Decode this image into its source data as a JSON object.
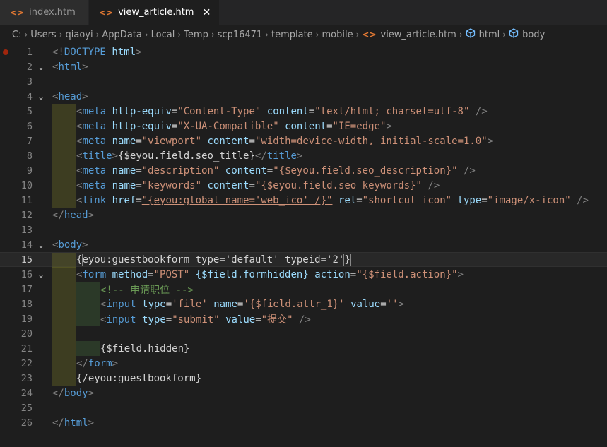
{
  "tabs": [
    {
      "label": "index.htm",
      "active": false
    },
    {
      "label": "view_article.htm",
      "active": true
    }
  ],
  "close_glyph": "✕",
  "breadcrumb": [
    "C:",
    "Users",
    "qiaoyi",
    "AppData",
    "Local",
    "Temp",
    "scp16471",
    "template",
    "mobile",
    "view_article.htm",
    "html",
    "body"
  ],
  "editor": {
    "current_line": 15,
    "breakpoint_line": 1,
    "lines": [
      {
        "n": 1,
        "fold": false,
        "guides": 0,
        "tokens": [
          [
            "br",
            "<!"
          ],
          [
            "tag",
            "DOCTYPE"
          ],
          [
            "txt",
            " "
          ],
          [
            "attr",
            "html"
          ],
          [
            "br",
            ">"
          ]
        ]
      },
      {
        "n": 2,
        "fold": true,
        "guides": 0,
        "tokens": [
          [
            "br",
            "<"
          ],
          [
            "tag",
            "html"
          ],
          [
            "br",
            ">"
          ]
        ]
      },
      {
        "n": 3,
        "fold": false,
        "guides": 0,
        "tokens": []
      },
      {
        "n": 4,
        "fold": true,
        "guides": 0,
        "tokens": [
          [
            "br",
            "<"
          ],
          [
            "tag",
            "head"
          ],
          [
            "br",
            ">"
          ]
        ]
      },
      {
        "n": 5,
        "fold": false,
        "guides": 1,
        "tokens": [
          [
            "br",
            "<"
          ],
          [
            "tag",
            "meta"
          ],
          [
            "txt",
            " "
          ],
          [
            "attr",
            "http-equiv"
          ],
          [
            "txt",
            "="
          ],
          [
            "str",
            "\"Content-Type\""
          ],
          [
            "txt",
            " "
          ],
          [
            "attr",
            "content"
          ],
          [
            "txt",
            "="
          ],
          [
            "str",
            "\"text/html; charset=utf-8\""
          ],
          [
            "txt",
            " "
          ],
          [
            "br",
            "/>"
          ]
        ]
      },
      {
        "n": 6,
        "fold": false,
        "guides": 1,
        "tokens": [
          [
            "br",
            "<"
          ],
          [
            "tag",
            "meta"
          ],
          [
            "txt",
            " "
          ],
          [
            "attr",
            "http-equiv"
          ],
          [
            "txt",
            "="
          ],
          [
            "str",
            "\"X-UA-Compatible\""
          ],
          [
            "txt",
            " "
          ],
          [
            "attr",
            "content"
          ],
          [
            "txt",
            "="
          ],
          [
            "str",
            "\"IE=edge\""
          ],
          [
            "br",
            ">"
          ]
        ]
      },
      {
        "n": 7,
        "fold": false,
        "guides": 1,
        "tokens": [
          [
            "br",
            "<"
          ],
          [
            "tag",
            "meta"
          ],
          [
            "txt",
            " "
          ],
          [
            "attr",
            "name"
          ],
          [
            "txt",
            "="
          ],
          [
            "str",
            "\"viewport\""
          ],
          [
            "txt",
            " "
          ],
          [
            "attr",
            "content"
          ],
          [
            "txt",
            "="
          ],
          [
            "str",
            "\"width=device-width, initial-scale=1.0\""
          ],
          [
            "br",
            ">"
          ]
        ]
      },
      {
        "n": 8,
        "fold": false,
        "guides": 1,
        "tokens": [
          [
            "br",
            "<"
          ],
          [
            "tag",
            "title"
          ],
          [
            "br",
            ">"
          ],
          [
            "txt",
            "{$eyou.field.seo_title}"
          ],
          [
            "br",
            "</"
          ],
          [
            "tag",
            "title"
          ],
          [
            "br",
            ">"
          ]
        ]
      },
      {
        "n": 9,
        "fold": false,
        "guides": 1,
        "tokens": [
          [
            "br",
            "<"
          ],
          [
            "tag",
            "meta"
          ],
          [
            "txt",
            " "
          ],
          [
            "attr",
            "name"
          ],
          [
            "txt",
            "="
          ],
          [
            "str",
            "\"description\""
          ],
          [
            "txt",
            " "
          ],
          [
            "attr",
            "content"
          ],
          [
            "txt",
            "="
          ],
          [
            "str",
            "\"{$eyou.field.seo_description}\""
          ],
          [
            "txt",
            " "
          ],
          [
            "br",
            "/>"
          ]
        ]
      },
      {
        "n": 10,
        "fold": false,
        "guides": 1,
        "tokens": [
          [
            "br",
            "<"
          ],
          [
            "tag",
            "meta"
          ],
          [
            "txt",
            " "
          ],
          [
            "attr",
            "name"
          ],
          [
            "txt",
            "="
          ],
          [
            "str",
            "\"keywords\""
          ],
          [
            "txt",
            " "
          ],
          [
            "attr",
            "content"
          ],
          [
            "txt",
            "="
          ],
          [
            "str",
            "\"{$eyou.field.seo_keywords}\""
          ],
          [
            "txt",
            " "
          ],
          [
            "br",
            "/>"
          ]
        ]
      },
      {
        "n": 11,
        "fold": false,
        "guides": 1,
        "tokens": [
          [
            "br",
            "<"
          ],
          [
            "tag",
            "link"
          ],
          [
            "txt",
            " "
          ],
          [
            "attr",
            "href"
          ],
          [
            "txt",
            "="
          ],
          [
            "strul",
            "\"{eyou:global name='web_ico' /}\""
          ],
          [
            "txt",
            " "
          ],
          [
            "attr",
            "rel"
          ],
          [
            "txt",
            "="
          ],
          [
            "str",
            "\"shortcut icon\""
          ],
          [
            "txt",
            " "
          ],
          [
            "attr",
            "type"
          ],
          [
            "txt",
            "="
          ],
          [
            "str",
            "\"image/x-icon\""
          ],
          [
            "txt",
            " "
          ],
          [
            "br",
            "/>"
          ]
        ]
      },
      {
        "n": 12,
        "fold": false,
        "guides": 0,
        "tokens": [
          [
            "br",
            "</"
          ],
          [
            "tag",
            "head"
          ],
          [
            "br",
            ">"
          ]
        ]
      },
      {
        "n": 13,
        "fold": false,
        "guides": 0,
        "tokens": []
      },
      {
        "n": 14,
        "fold": true,
        "guides": 0,
        "tokens": [
          [
            "br",
            "<"
          ],
          [
            "tag",
            "body"
          ],
          [
            "br",
            ">"
          ]
        ]
      },
      {
        "n": 15,
        "fold": false,
        "guides": 1,
        "tokens": [
          [
            "box",
            "{"
          ],
          [
            "txt",
            "eyou:guestbookform type='default' typeid='2'"
          ],
          [
            "box",
            "}"
          ]
        ]
      },
      {
        "n": 16,
        "fold": true,
        "guides": 1,
        "tokens": [
          [
            "br",
            "<"
          ],
          [
            "tag",
            "form"
          ],
          [
            "txt",
            " "
          ],
          [
            "attr",
            "method"
          ],
          [
            "txt",
            "="
          ],
          [
            "str",
            "\"POST\""
          ],
          [
            "txt",
            " "
          ],
          [
            "attr",
            "{$field.formhidden}"
          ],
          [
            "txt",
            " "
          ],
          [
            "attr",
            "action"
          ],
          [
            "txt",
            "="
          ],
          [
            "str",
            "\"{$field.action}\""
          ],
          [
            "br",
            ">"
          ]
        ]
      },
      {
        "n": 17,
        "fold": false,
        "guides": 2,
        "tokens": [
          [
            "com",
            "<!-- 申请职位 -->"
          ]
        ]
      },
      {
        "n": 18,
        "fold": false,
        "guides": 2,
        "tokens": [
          [
            "br",
            "<"
          ],
          [
            "tag",
            "input"
          ],
          [
            "txt",
            " "
          ],
          [
            "attr",
            "type"
          ],
          [
            "txt",
            "="
          ],
          [
            "str",
            "'file'"
          ],
          [
            "txt",
            " "
          ],
          [
            "attr",
            "name"
          ],
          [
            "txt",
            "="
          ],
          [
            "str",
            "'{$field.attr_1}'"
          ],
          [
            "txt",
            " "
          ],
          [
            "attr",
            "value"
          ],
          [
            "txt",
            "="
          ],
          [
            "str",
            "''"
          ],
          [
            "br",
            ">"
          ]
        ]
      },
      {
        "n": 19,
        "fold": false,
        "guides": 2,
        "tokens": [
          [
            "br",
            "<"
          ],
          [
            "tag",
            "input"
          ],
          [
            "txt",
            " "
          ],
          [
            "attr",
            "type"
          ],
          [
            "txt",
            "="
          ],
          [
            "str",
            "\"submit\""
          ],
          [
            "txt",
            " "
          ],
          [
            "attr",
            "value"
          ],
          [
            "txt",
            "="
          ],
          [
            "str",
            "\"提交\""
          ],
          [
            "txt",
            " "
          ],
          [
            "br",
            "/>"
          ]
        ]
      },
      {
        "n": 20,
        "fold": false,
        "guides": 1,
        "tokens": []
      },
      {
        "n": 21,
        "fold": false,
        "guides": 2,
        "tokens": [
          [
            "txt",
            "{$field.hidden}"
          ]
        ]
      },
      {
        "n": 22,
        "fold": false,
        "guides": 1,
        "tokens": [
          [
            "br",
            "</"
          ],
          [
            "tag",
            "form"
          ],
          [
            "br",
            ">"
          ]
        ]
      },
      {
        "n": 23,
        "fold": false,
        "guides": 1,
        "tokens": [
          [
            "txt",
            "{/eyou:guestbookform}"
          ]
        ]
      },
      {
        "n": 24,
        "fold": false,
        "guides": 0,
        "tokens": [
          [
            "br",
            "</"
          ],
          [
            "tag",
            "body"
          ],
          [
            "br",
            ">"
          ]
        ]
      },
      {
        "n": 25,
        "fold": false,
        "guides": 0,
        "tokens": []
      },
      {
        "n": 26,
        "fold": false,
        "guides": 0,
        "tokens": [
          [
            "br",
            "</"
          ],
          [
            "tag",
            "html"
          ],
          [
            "br",
            ">"
          ]
        ]
      }
    ]
  }
}
